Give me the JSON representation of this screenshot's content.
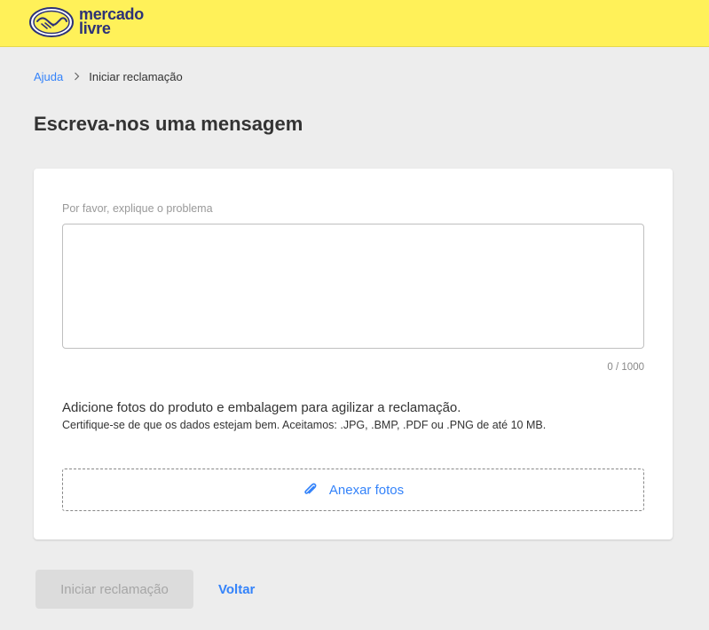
{
  "header": {
    "brand_line1": "mercado",
    "brand_line2": "livre",
    "brand_color": "#fff159",
    "logo_icon": "handshake-logo-icon"
  },
  "breadcrumb": {
    "parent": "Ajuda",
    "separator_icon": "chevron-right-icon",
    "current": "Iniciar reclamação"
  },
  "page": {
    "title": "Escreva-nos uma mensagem"
  },
  "form": {
    "problem_label": "Por favor, explique o problema",
    "problem_value": "",
    "char_counter": "0 / 1000",
    "photos_title": "Adicione fotos do produto e embalagem para agilizar a reclamação.",
    "photos_subtitle": "Certifique-se de que os dados estejam bem. Aceitamos: .JPG, .BMP, .PDF ou .PNG de até 10 MB.",
    "attach_icon": "paperclip-icon",
    "attach_label": "Anexar fotos"
  },
  "actions": {
    "submit_label": "Iniciar reclamação",
    "submit_disabled": true,
    "back_label": "Voltar"
  },
  "colors": {
    "accent": "#3483fa",
    "disabled_bg": "#dcdcdc",
    "background": "#ededed"
  }
}
